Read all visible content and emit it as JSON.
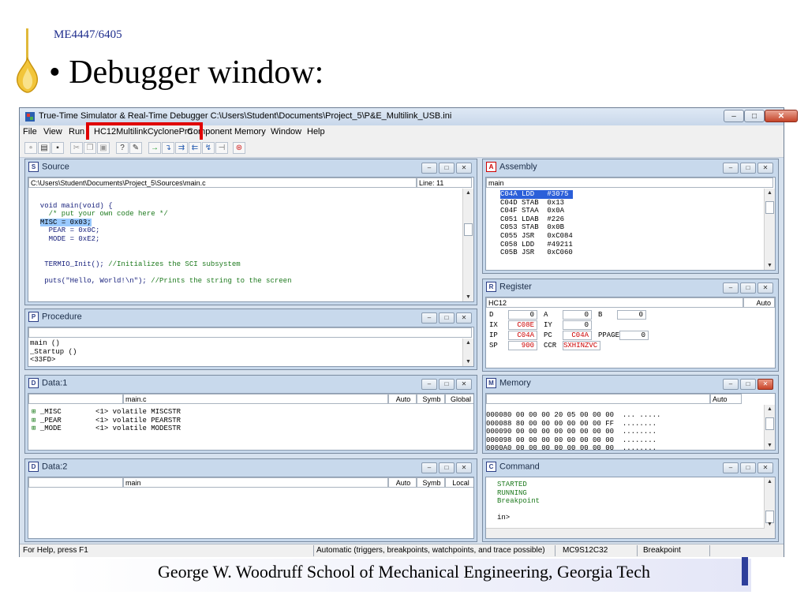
{
  "slide": {
    "course_code": "ME4447/6405",
    "heading": "Debugger window:",
    "footer": "George W. Woodruff School of Mechanical Engineering, Georgia Tech"
  },
  "window": {
    "title": "True-Time Simulator & Real-Time Debugger   C:\\Users\\Student\\Documents\\Project_5\\P&E_Multilink_USB.ini",
    "menu": [
      "File",
      "View",
      "Run",
      "HC12MultilinkCyclonePro",
      "Component",
      "Memory",
      "Window",
      "Help"
    ],
    "highlighted_menu": "HC12MultilinkCyclonePro",
    "status": {
      "help": "For Help, press F1",
      "mode": "Automatic (triggers, breakpoints, watchpoints, and trace possible)",
      "target": "MC9S12C32",
      "state": "Breakpoint"
    }
  },
  "source": {
    "title": "Source",
    "path": "C:\\Users\\Student\\Documents\\Project_5\\Sources\\main.c",
    "line": "Line: 11",
    "lines": [
      "",
      "  void main(void) {",
      "    /* put your own code here */",
      "  MISC = 0x03;",
      "    PEAR = 0x0C;",
      "    MODE = 0xE2;",
      "",
      "",
      "   TERMIO_Init(); //Initializes the SCI subsystem",
      "",
      "   puts(\"Hello, World!\\n\"); //Prints the string to the screen"
    ],
    "highlight_text": "MISC = 0x03;"
  },
  "procedure": {
    "title": "Procedure",
    "lines": [
      "main ()",
      "_Startup ()",
      "<33FD>"
    ]
  },
  "data1": {
    "title": "Data:1",
    "module": "main.c",
    "buttons": [
      "Auto",
      "Symb",
      "Global"
    ],
    "rows": [
      {
        "name": "_MISC",
        "value": "<1> volatile MISCSTR"
      },
      {
        "name": "_PEAR",
        "value": "<1> volatile PEARSTR"
      },
      {
        "name": "_MODE",
        "value": "<1> volatile MODESTR"
      }
    ]
  },
  "data2": {
    "title": "Data:2",
    "module": "main",
    "buttons": [
      "Auto",
      "Symb",
      "Local"
    ]
  },
  "assembly": {
    "title": "Assembly",
    "function": "main",
    "lines": [
      "C04A LDD   #3075",
      "C04D STAB  0x13",
      "C04F STAA  0x0A",
      "C051 LDAB  #226",
      "C053 STAB  0x0B",
      "C055 JSR   0xC084",
      "C058 LDD   #49211",
      "C05B JSR   0xC060"
    ]
  },
  "register": {
    "title": "Register",
    "cpu": "HC12",
    "mode": "Auto",
    "rows": [
      [
        {
          "label": "D",
          "value": "0"
        },
        {
          "label": "A",
          "value": "0"
        },
        {
          "label": "B",
          "value": "0"
        }
      ],
      [
        {
          "label": "IX",
          "value": "C08E"
        },
        {
          "label": "IY",
          "value": "0"
        }
      ],
      [
        {
          "label": "IP",
          "value": "C04A"
        },
        {
          "label": "PC",
          "value": "C04A"
        },
        {
          "label": "PPAGE",
          "value": "0"
        }
      ],
      [
        {
          "label": "SP",
          "value": "900"
        },
        {
          "label": "CCR",
          "value": "SXHINZVC"
        }
      ]
    ]
  },
  "memory": {
    "title": "Memory",
    "mode": "Auto",
    "lines": [
      "000080 00 00 00 20 05 00 00 00  ... .....",
      "000088 80 00 00 00 00 00 00 FF  ........",
      "000090 00 00 00 00 00 00 00 00  ........",
      "000098 00 00 00 00 00 00 00 00  ........",
      "0000A0 00 00 00 00 00 00 00 00  ........"
    ]
  },
  "command": {
    "title": "Command",
    "lines": [
      "STARTED",
      "RUNNING",
      "Breakpoint",
      "",
      "in>"
    ]
  },
  "colors": {
    "accent_blue": "#1d2c8c",
    "highlight_red": "#e00000",
    "selection": "#99c9ff"
  }
}
